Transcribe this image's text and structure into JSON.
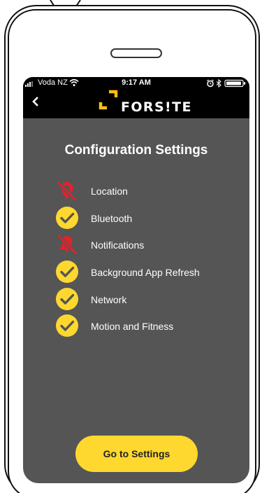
{
  "status_bar": {
    "carrier": "Voda NZ",
    "time": "9:17 AM"
  },
  "header": {
    "logo_text": "FORS!TE",
    "back_icon": "chevron-left-icon"
  },
  "page": {
    "title": "Configuration Settings"
  },
  "settings": [
    {
      "label": "Location",
      "status": "disabled",
      "icon": "location-off-icon"
    },
    {
      "label": "Bluetooth",
      "status": "enabled",
      "icon": "check-circle-icon"
    },
    {
      "label": "Notifications",
      "status": "disabled",
      "icon": "notifications-off-icon"
    },
    {
      "label": "Background App Refresh",
      "status": "enabled",
      "icon": "check-circle-icon"
    },
    {
      "label": "Network",
      "status": "enabled",
      "icon": "check-circle-icon"
    },
    {
      "label": "Motion and Fitness",
      "status": "enabled",
      "icon": "check-circle-icon"
    }
  ],
  "actions": {
    "go_to_settings_label": "Go to Settings"
  },
  "colors": {
    "screen_bg": "#555555",
    "header_bg": "#000000",
    "accent_yellow": "#ffd82f",
    "disabled_red": "#e8202a",
    "text": "#ffffff"
  }
}
